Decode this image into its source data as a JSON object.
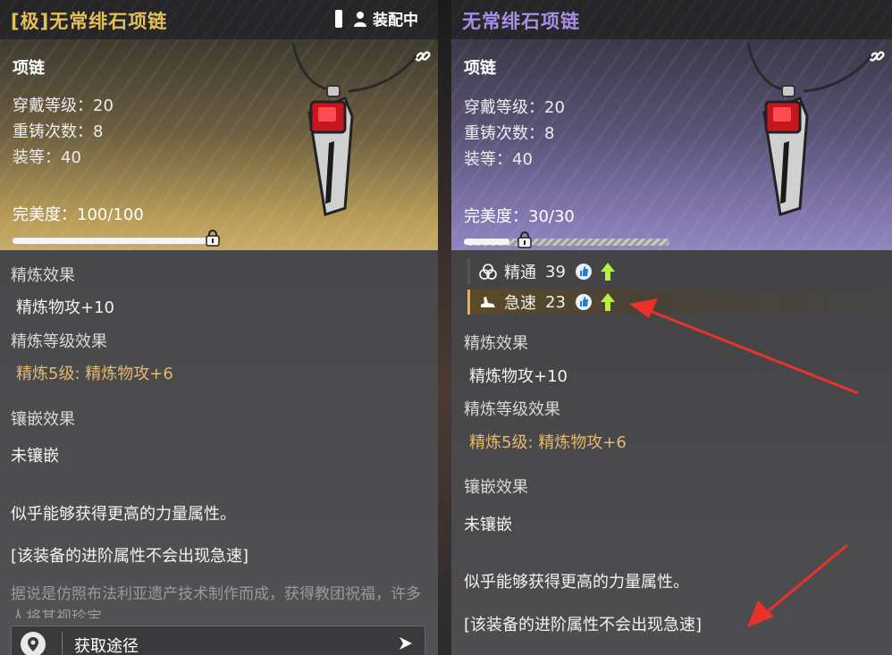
{
  "left": {
    "title": "[极]无常绯石项链",
    "equip_state": "装配中",
    "item_type": "项链",
    "stats": [
      "穿戴等级：20",
      "重铸次数：8",
      "装等：40"
    ],
    "perfection": "完美度：100/100",
    "perfection_fraction": 1.0,
    "refine_title": "精炼效果",
    "refine_value": "精炼物攻+10",
    "refine_level_title": "精炼等级效果",
    "refine_level_value": "精炼5级: 精炼物攻+6",
    "inlay_title": "镶嵌效果",
    "inlay_value": "未镶嵌",
    "desc": "似乎能够获得更高的力量属性。",
    "note": "[该装备的进阶属性不会出现急速]",
    "lore": "据说是仿照布法利亚遗产技术制作而成，获得教团祝福，许多人将其视珍宝。",
    "source_label": "获取途径"
  },
  "right": {
    "title": "无常绯石项链",
    "item_type": "项链",
    "stats": [
      "穿戴等级：20",
      "重铸次数：8",
      "装等：40"
    ],
    "perfection": "完美度：30/30",
    "perfection_fraction": 0.3,
    "sub_attrs": [
      {
        "name": "精通",
        "value": "39"
      },
      {
        "name": "急速",
        "value": "23"
      }
    ],
    "refine_title": "精炼效果",
    "refine_value": "精炼物攻+10",
    "refine_level_title": "精炼等级效果",
    "refine_level_value": "精炼5级: 精炼物攻+6",
    "inlay_title": "镶嵌效果",
    "inlay_value": "未镶嵌",
    "desc": "似乎能够获得更高的力量属性。",
    "note": "[该装备的进阶属性不会出现急速]"
  },
  "icons": {
    "equip": "person-icon",
    "link": "link-icon",
    "lock": "lock-icon",
    "mastery": "mastery-icon",
    "haste": "haste-icon",
    "thumb": "thumbs-up-icon",
    "up": "arrow-up-icon",
    "pin": "location-pin-icon",
    "go": "play-arrow-icon"
  },
  "colors": {
    "legendary_title": "#e5c05a",
    "epic_title": "#a98ee8",
    "refine_level": "#e6b86e",
    "up_arrow": "#b8f040",
    "annotation": "#e8322a"
  }
}
